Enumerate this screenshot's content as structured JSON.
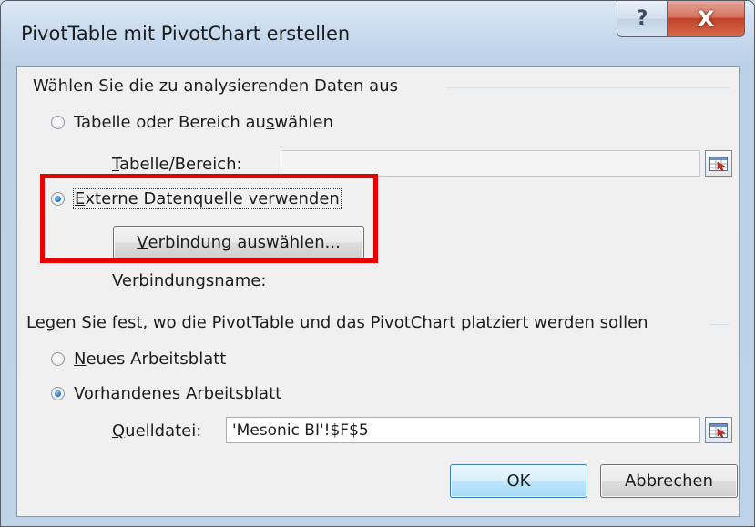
{
  "window": {
    "title": "PivotTable mit PivotChart erstellen",
    "help_label": "?",
    "close_label": "X"
  },
  "section1": {
    "header": "Wählen Sie die zu analysierenden Daten aus",
    "radio_table": {
      "pre": "Tabelle oder Bereich au",
      "ul": "s",
      "post": "wählen",
      "checked": false
    },
    "table_range_label": {
      "ul": "T",
      "post": "abelle/Bereich:"
    },
    "table_range_value": "",
    "radio_external": {
      "ul": "E",
      "post": "xterne Datenquelle verwenden",
      "checked": true
    },
    "choose_connection_button": {
      "ul": "V",
      "post": "erbindung auswählen..."
    },
    "connection_name_label": "Verbindungsname:"
  },
  "section2": {
    "header": "Legen Sie fest, wo die PivotTable und das PivotChart platziert werden sollen",
    "radio_new_sheet": {
      "ul": "N",
      "post": "eues Arbeitsblatt",
      "checked": false
    },
    "radio_existing_sheet": {
      "pre": "Vorhand",
      "ul": "e",
      "post": "nes Arbeitsblatt",
      "checked": true
    },
    "source_label": {
      "ul": "Q",
      "post": "uelldatei:"
    },
    "source_value": "'Mesonic BI'!$F$5"
  },
  "buttons": {
    "ok": "OK",
    "cancel": "Abbrechen"
  },
  "colors": {
    "highlight": "#e60000",
    "accent": "#3c7fb1"
  }
}
